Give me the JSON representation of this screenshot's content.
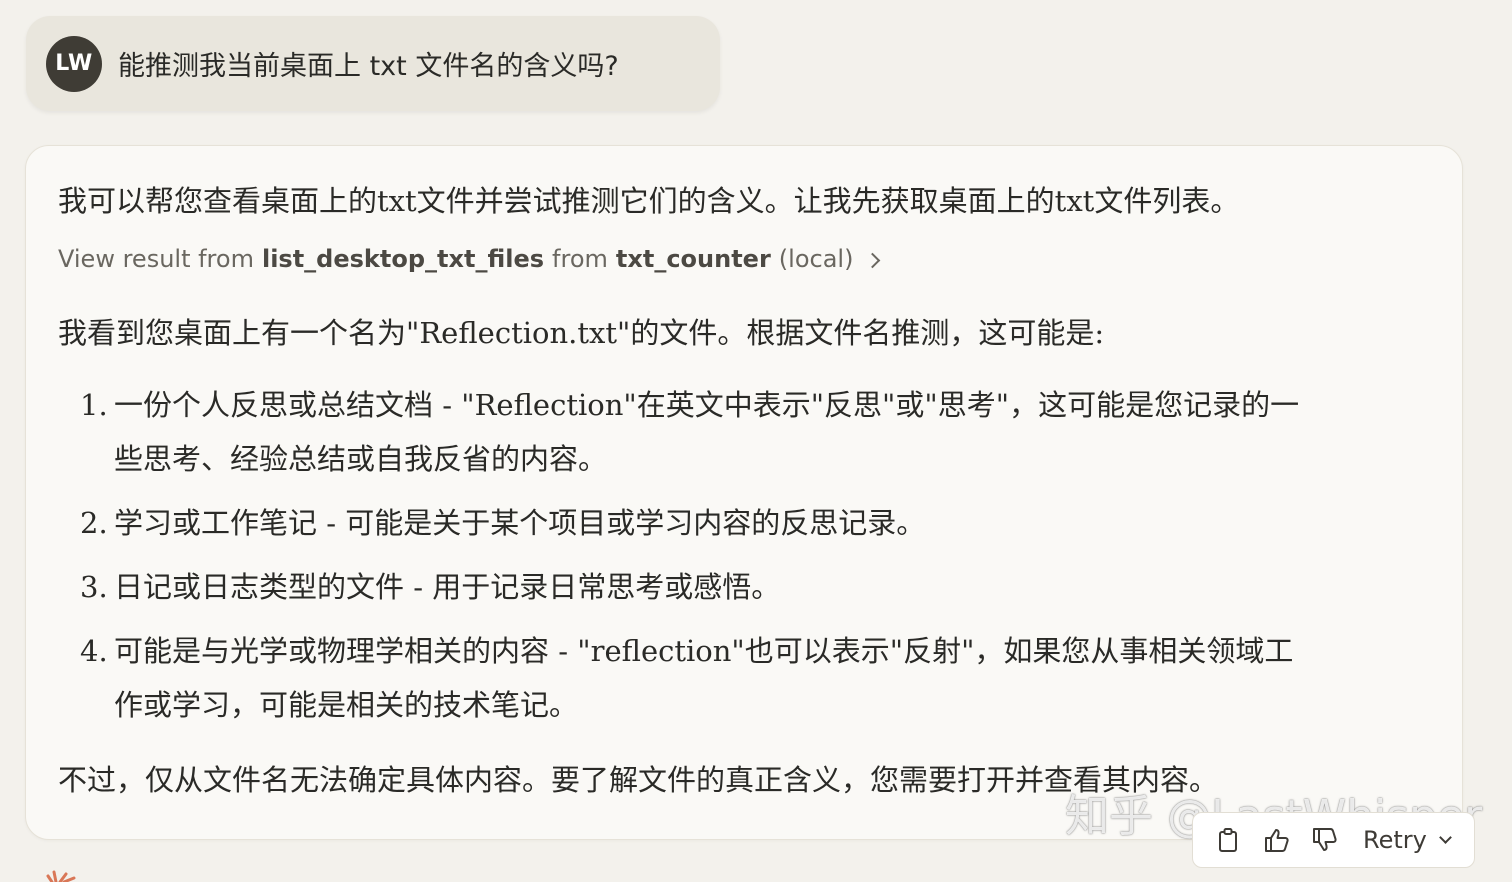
{
  "user_message": {
    "avatar_initials": "LW",
    "text": "能推测我当前桌面上 txt 文件名的含义吗?"
  },
  "assistant": {
    "intro": "我可以帮您查看桌面上的txt文件并尝试推测它们的含义。让我先获取桌面上的txt文件列表。",
    "tool_result": {
      "prefix": "View result from",
      "tool_name": "list_desktop_txt_files",
      "from_word": "from",
      "server_name": "txt_counter",
      "suffix": "(local)"
    },
    "found_text": "我看到您桌面上有一个名为\"Reflection.txt\"的文件。根据文件名推测，这可能是:",
    "list": [
      {
        "num": "1.",
        "line1": "一份个人反思或总结文档 - \"Reflection\"在英文中表示\"反思\"或\"思考\"，这可能是您记录的一",
        "line2": "些思考、经验总结或自我反省的内容。"
      },
      {
        "num": "2.",
        "line1": "学习或工作笔记 - 可能是关于某个项目或学习内容的反思记录。",
        "line2": ""
      },
      {
        "num": "3.",
        "line1": "日记或日志类型的文件 - 用于记录日常思考或感悟。",
        "line2": ""
      },
      {
        "num": "4.",
        "line1": "可能是与光学或物理学相关的内容 - \"reflection\"也可以表示\"反射\"，如果您从事相关领域工",
        "line2": "作或学习，可能是相关的技术笔记。"
      }
    ],
    "closing": "不过，仅从文件名无法确定具体内容。要了解文件的真正含义，您需要打开并查看其内容。"
  },
  "actions": {
    "retry_label": "Retry"
  },
  "watermark": "知乎 @LastWhisper",
  "icons": [
    "copy-icon",
    "thumbs-up-icon",
    "thumbs-down-icon",
    "chevron-down-icon",
    "chevron-right-icon",
    "claude-logo-icon"
  ],
  "colors": {
    "background": "#f3f1ec",
    "user_bubble": "#e9e6dd",
    "card": "#faf9f6",
    "avatar": "#3f3c35",
    "accent_logo": "#d97757"
  }
}
